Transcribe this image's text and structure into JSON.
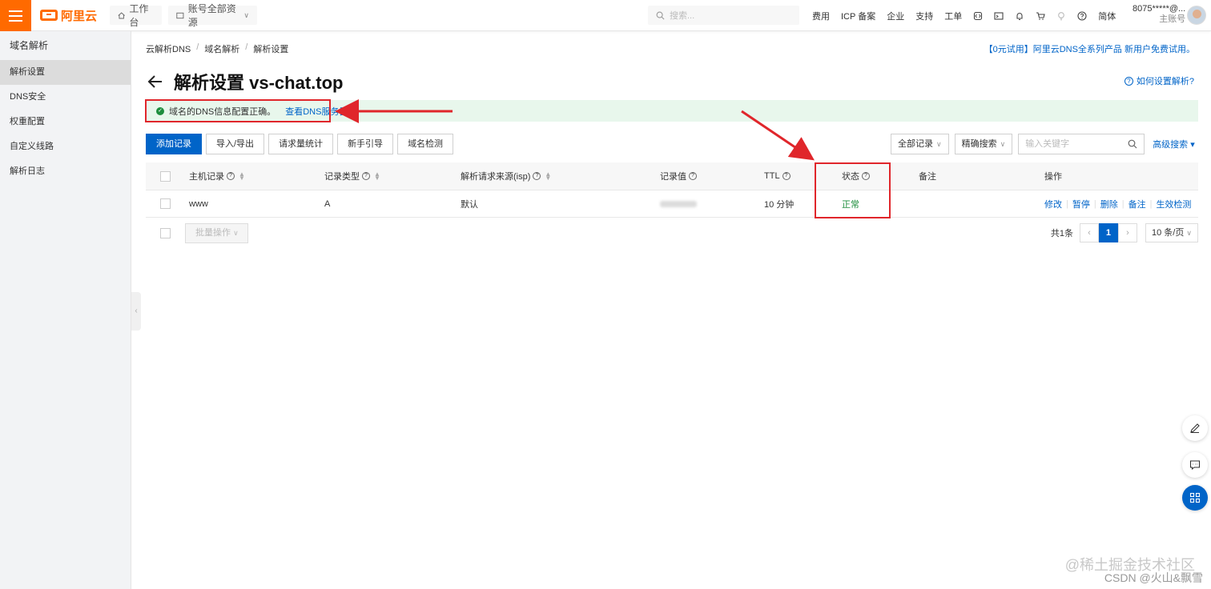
{
  "topbar": {
    "logo_text": "阿里云",
    "workbench": "工作台",
    "resources": "账号全部资源",
    "search_placeholder": "搜索...",
    "links": [
      "费用",
      "ICP 备案",
      "企业",
      "支持",
      "工单"
    ],
    "lang": "简体",
    "account_name": "8075*****@...",
    "account_role": "主账号"
  },
  "sidebar": {
    "title": "域名解析",
    "items": [
      {
        "label": "解析设置",
        "active": true
      },
      {
        "label": "DNS安全",
        "active": false
      },
      {
        "label": "权重配置",
        "active": false
      },
      {
        "label": "自定义线路",
        "active": false
      },
      {
        "label": "解析日志",
        "active": false
      }
    ]
  },
  "breadcrumb": [
    "云解析DNS",
    "域名解析",
    "解析设置"
  ],
  "promo": "【0元试用】阿里云DNS全系列产品 新用户免费试用。",
  "page_title": "解析设置 vs-chat.top",
  "help_link": "如何设置解析?",
  "notice": {
    "text": "域名的DNS信息配置正确。",
    "link": "查看DNS服务器"
  },
  "toolbar": {
    "add": "添加记录",
    "import_export": "导入/导出",
    "stats": "请求量统计",
    "guide": "新手引导",
    "check": "域名检测"
  },
  "filters": {
    "all_records": "全部记录",
    "exact_search": "精确搜索",
    "keyword_placeholder": "输入关键字",
    "advanced": "高级搜索"
  },
  "table": {
    "headers": {
      "host": "主机记录",
      "type": "记录类型",
      "line": "解析请求来源(isp)",
      "value": "记录值",
      "ttl": "TTL",
      "status": "状态",
      "remark": "备注",
      "ops": "操作"
    },
    "rows": [
      {
        "host": "www",
        "type": "A",
        "line": "默认",
        "ttl": "10 分钟",
        "status": "正常",
        "remark": ""
      }
    ],
    "actions": [
      "修改",
      "暂停",
      "删除",
      "备注",
      "生效检测"
    ]
  },
  "bulk_label": "批量操作",
  "pager": {
    "total": "共1条",
    "current": "1",
    "page_size": "10 条/页"
  },
  "watermark": {
    "line1": "@稀土掘金技术社区",
    "line2": "CSDN @火山&飘雪"
  },
  "colors": {
    "brand": "#ff6a00",
    "primary": "#0064c8",
    "success": "#1e8e3e",
    "annotation": "#e0262b"
  }
}
